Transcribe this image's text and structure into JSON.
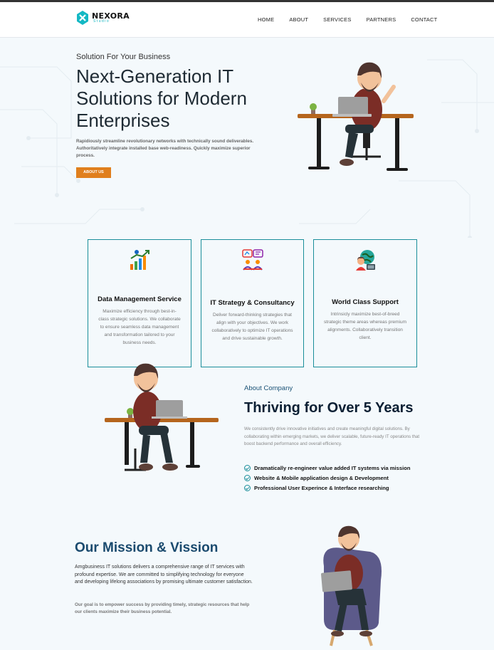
{
  "brand": {
    "name": "NEXORA",
    "subtitle": "Studio",
    "accent": "#14b8c4"
  },
  "nav": [
    "HOME",
    "ABOUT",
    "SERVICES",
    "PARTNERS",
    "CONTACT"
  ],
  "hero": {
    "eyebrow": "Solution For Your Business",
    "title": "Next-Generation IT Solutions for Modern Enterprises",
    "description": "Rapidiously streamline revolutionary networks with technically sound deliverables. Authoritatively integrate installed base web-readiness. Quickly maximize superior process.",
    "button": "ABOUT US",
    "button_color": "#e07f1d"
  },
  "services": [
    {
      "icon": "growth-chart-icon",
      "title": "Data Management Service",
      "text": "Maximize efficiency through best-in-class strategic solutions. We collaborate to ensure seamless data management and transformation tailored to your business needs."
    },
    {
      "icon": "strategy-consulting-icon",
      "title": "IT Strategy & Consultancy",
      "text": "Deliver forward-thinking strategies that align with your objectives. We work collaboratively to optimize IT operations and drive sustainable growth."
    },
    {
      "icon": "global-support-icon",
      "title": "World Class Support",
      "text": "Intrinsicly maximize best-of-breed strategic theme areas whereas premium alignments. Collaboratively transition client."
    }
  ],
  "about": {
    "eyebrow": "About Company",
    "title": "Thriving for Over 5 Years",
    "description": "We consistently drive innovative initiatives and create meaningful digital solutions. By collaborating within emerging markets, we deliver scalable, future-ready IT operations that boost backend performance and overall efficiency.",
    "checks": [
      "Dramatically re-engineer value added IT systems via mission",
      "Website & Mobile application design & Development",
      "Professional User Experince & Interface researching"
    ]
  },
  "mission": {
    "title": "Our Mission & Vission",
    "p1": "Amgbusiness IT solutions delivers a comprehensive range of IT services with profound expertise. We are committed to simplifying technology for everyone and developing lifelong associations by promising ultimate customer satisfaction.",
    "p2": "Our goal is to empower success by providing timely, strategic resources that help our clients maximize their business potential."
  }
}
